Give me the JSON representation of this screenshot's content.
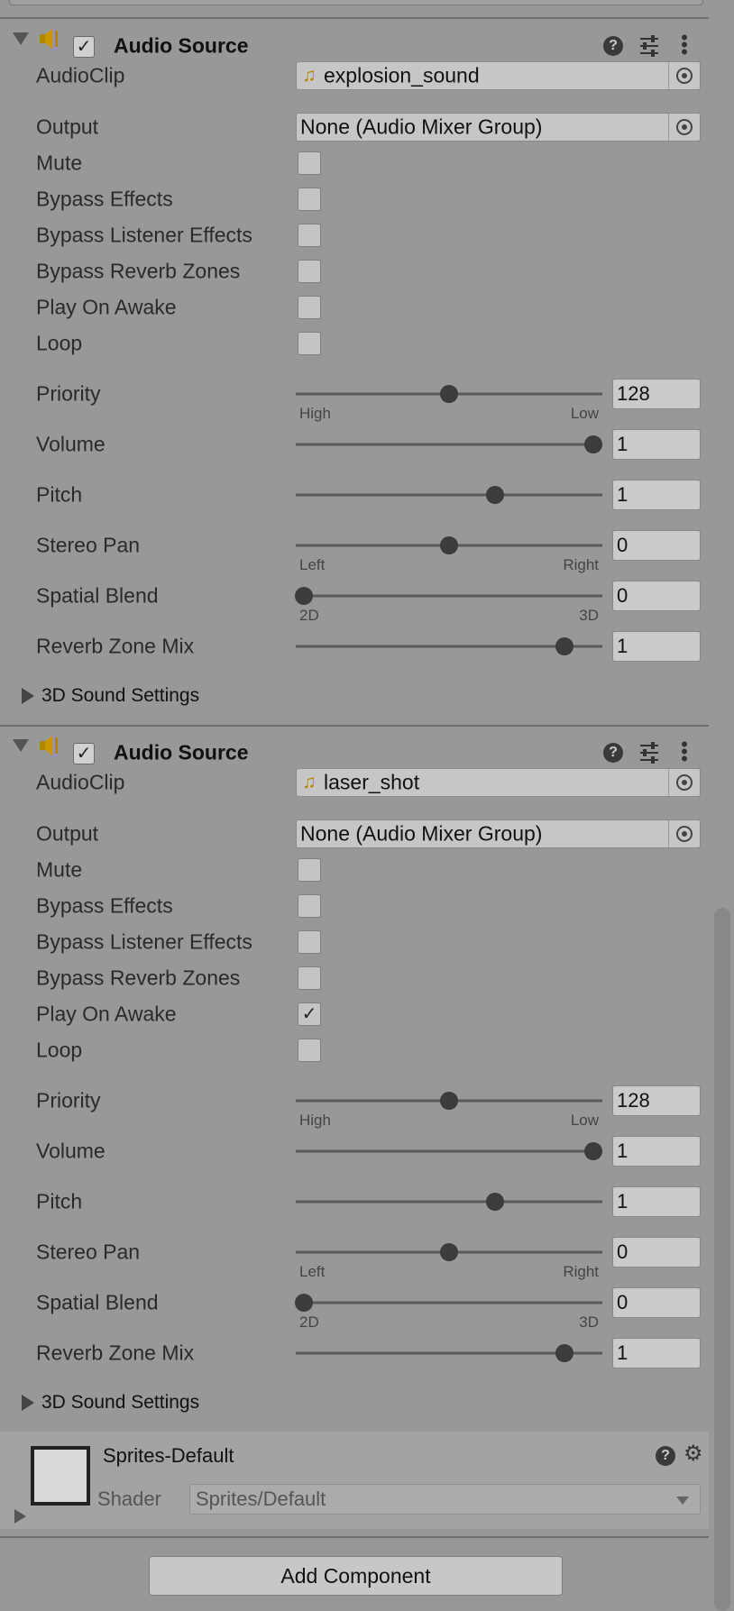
{
  "components": [
    {
      "title": "Audio Source",
      "enabled": true,
      "audio_clip": {
        "label": "AudioClip",
        "value": "explosion_sound"
      },
      "output": {
        "label": "Output",
        "value": "None (Audio Mixer Group)"
      },
      "toggles": [
        {
          "label": "Mute",
          "checked": false
        },
        {
          "label": "Bypass Effects",
          "checked": false
        },
        {
          "label": "Bypass Listener Effects",
          "checked": false
        },
        {
          "label": "Bypass Reverb Zones",
          "checked": false
        },
        {
          "label": "Play On Awake",
          "checked": false
        },
        {
          "label": "Loop",
          "checked": false
        }
      ],
      "sliders": [
        {
          "label": "Priority",
          "value": "128",
          "min_label": "High",
          "max_label": "Low",
          "fraction": 0.5
        },
        {
          "label": "Volume",
          "value": "1",
          "min_label": "",
          "max_label": "",
          "fraction": 1.0
        },
        {
          "label": "Pitch",
          "value": "1",
          "min_label": "",
          "max_label": "",
          "fraction": 0.66
        },
        {
          "label": "Stereo Pan",
          "value": "0",
          "min_label": "Left",
          "max_label": "Right",
          "fraction": 0.5
        },
        {
          "label": "Spatial Blend",
          "value": "0",
          "min_label": "2D",
          "max_label": "3D",
          "fraction": 0.0
        },
        {
          "label": "Reverb Zone Mix",
          "value": "1",
          "min_label": "",
          "max_label": "",
          "fraction": 0.9
        }
      ],
      "foldout": "3D Sound Settings"
    },
    {
      "title": "Audio Source",
      "enabled": true,
      "audio_clip": {
        "label": "AudioClip",
        "value": "laser_shot"
      },
      "output": {
        "label": "Output",
        "value": "None (Audio Mixer Group)"
      },
      "toggles": [
        {
          "label": "Mute",
          "checked": false
        },
        {
          "label": "Bypass Effects",
          "checked": false
        },
        {
          "label": "Bypass Listener Effects",
          "checked": false
        },
        {
          "label": "Bypass Reverb Zones",
          "checked": false
        },
        {
          "label": "Play On Awake",
          "checked": true
        },
        {
          "label": "Loop",
          "checked": false
        }
      ],
      "sliders": [
        {
          "label": "Priority",
          "value": "128",
          "min_label": "High",
          "max_label": "Low",
          "fraction": 0.5
        },
        {
          "label": "Volume",
          "value": "1",
          "min_label": "",
          "max_label": "",
          "fraction": 1.0
        },
        {
          "label": "Pitch",
          "value": "1",
          "min_label": "",
          "max_label": "",
          "fraction": 0.66
        },
        {
          "label": "Stereo Pan",
          "value": "0",
          "min_label": "Left",
          "max_label": "Right",
          "fraction": 0.5
        },
        {
          "label": "Spatial Blend",
          "value": "0",
          "min_label": "2D",
          "max_label": "3D",
          "fraction": 0.0
        },
        {
          "label": "Reverb Zone Mix",
          "value": "1",
          "min_label": "",
          "max_label": "",
          "fraction": 0.9
        }
      ],
      "foldout": "3D Sound Settings"
    }
  ],
  "material": {
    "name": "Sprites-Default",
    "shader_label": "Shader",
    "shader_value": "Sprites/Default"
  },
  "add_component_label": "Add Component",
  "colors": {
    "accent_icon": "#b38600",
    "thumb": "#3c3c3c",
    "background": "#989898"
  }
}
